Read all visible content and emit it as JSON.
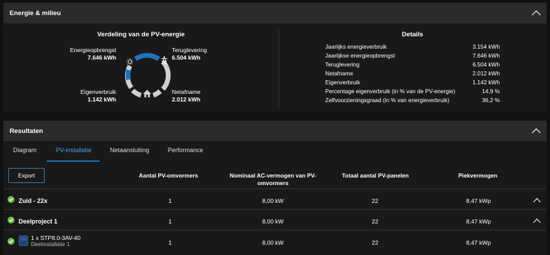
{
  "energie": {
    "title": "Energie & milieu",
    "distribution_title": "Verdeling van de PV-energie",
    "yield_label": "Energieopbrengst",
    "yield_value": "7.646 kWh",
    "feedin_label": "Teruglevering",
    "feedin_value": "6.504 kWh",
    "selfcons_label": "Eigenverbruik",
    "selfcons_value": "1.142 kWh",
    "grid_label": "Netafname",
    "grid_value": "2.012 kWh",
    "details_title": "Details",
    "details": [
      {
        "label": "Jaarlijks energieverbruik",
        "value": "3.154 kWh"
      },
      {
        "label": "Jaarlijkse energieopbrengst",
        "value": "7.646 kWh"
      },
      {
        "label": "Teruglevering",
        "value": "6.504 kWh"
      },
      {
        "label": "Netafname",
        "value": "2.012 kWh"
      },
      {
        "label": "Eigenverbruik",
        "value": "1.142 kWh"
      },
      {
        "label": "Percentage eigenverbruik (in % van de PV-energie)",
        "value": "14,9 %"
      },
      {
        "label": "Zelfvoorzieningsgraad (in % van energieverbruik)",
        "value": "36,2 %"
      }
    ],
    "colors": {
      "accent_blue": "#1e73be",
      "ring_grey": "#d0d0d0"
    }
  },
  "results": {
    "title": "Resultaten",
    "tabs": [
      "Diagram",
      "PV-installatie",
      "Netaansluiting",
      "Performance"
    ],
    "active_tab": "PV-installatie",
    "export_label": "Export",
    "columns": [
      "Aantal PV-omvormers",
      "Nominaal AC-vermogen van PV-omvormers",
      "Totaal aantal PV-panelen",
      "Piekvermogen"
    ],
    "rows": [
      {
        "name": "Zuid - 22x",
        "inverters": "1",
        "ac_power": "8,00 kW",
        "panels": "22",
        "peak": "8,47 kWp"
      },
      {
        "name": "Deelproject 1",
        "inverters": "1",
        "ac_power": "8,00 kW",
        "panels": "22",
        "peak": "8,47 kWp"
      },
      {
        "name": "1 x STP8.0-3AV-40",
        "sub": "Deelinstallatie 1",
        "inverters": "1",
        "ac_power": "8,00 kW",
        "panels": "22",
        "peak": "8,47 kWp"
      }
    ]
  }
}
